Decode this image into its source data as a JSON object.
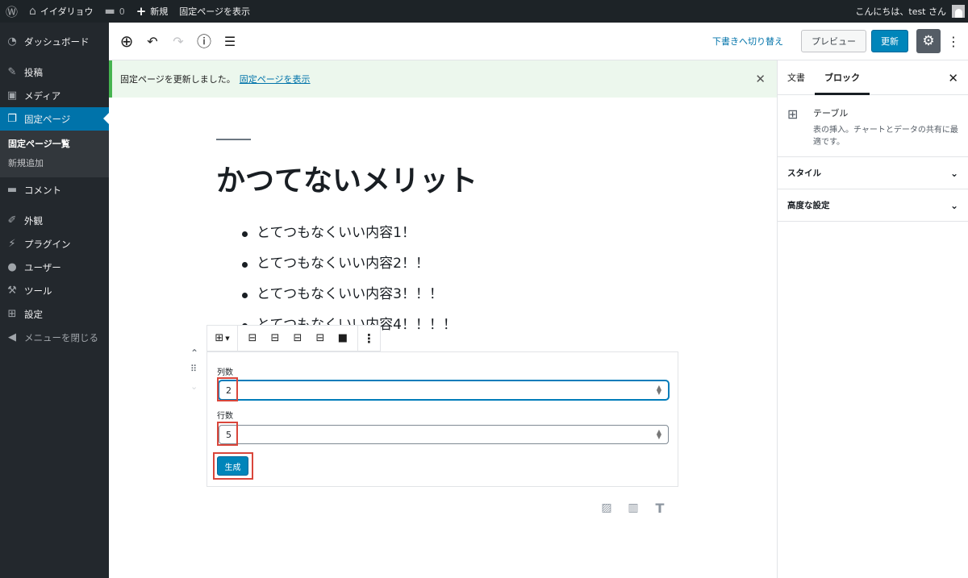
{
  "adminbar": {
    "site_name": "イイダリョウ",
    "comments_count": "0",
    "new_label": "新規",
    "view_page_label": "固定ページを表示",
    "greeting": "こんにちは、test さん"
  },
  "sidebar": {
    "items": [
      {
        "label": "ダッシュボード",
        "icon": "dashboard-icon"
      },
      {
        "label": "投稿",
        "icon": "pin-icon"
      },
      {
        "label": "メディア",
        "icon": "media-icon"
      },
      {
        "label": "固定ページ",
        "icon": "page-icon"
      },
      {
        "label": "コメント",
        "icon": "comment-icon"
      },
      {
        "label": "外観",
        "icon": "brush-icon"
      },
      {
        "label": "プラグイン",
        "icon": "plugin-icon"
      },
      {
        "label": "ユーザー",
        "icon": "user-icon"
      },
      {
        "label": "ツール",
        "icon": "wrench-icon"
      },
      {
        "label": "設定",
        "icon": "settings-icon"
      },
      {
        "label": "メニューを閉じる",
        "icon": "collapse-icon"
      }
    ],
    "submenu": [
      "固定ページ一覧",
      "新規追加"
    ]
  },
  "header": {
    "switch_draft": "下書きへ切り替え",
    "preview": "プレビュー",
    "update": "更新"
  },
  "notice": {
    "text": "固定ページを更新しました。",
    "link": "固定ページを表示"
  },
  "content": {
    "title": "かつてないメリット",
    "list": [
      "とてつもなくいい内容1！",
      "とてつもなくいい内容2！！",
      "とてつもなくいい内容3！！！",
      "とてつもなくいい内容4！！！！"
    ]
  },
  "table_block": {
    "columns_label": "列数",
    "columns_value": "2",
    "rows_label": "行数",
    "rows_value": "5",
    "generate": "生成"
  },
  "right_panel": {
    "tab_document": "文書",
    "tab_block": "ブロック",
    "block_name": "テーブル",
    "block_desc": "表の挿入。チャートとデータの共有に最適です。",
    "style_label": "スタイル",
    "advanced_label": "高度な設定"
  }
}
